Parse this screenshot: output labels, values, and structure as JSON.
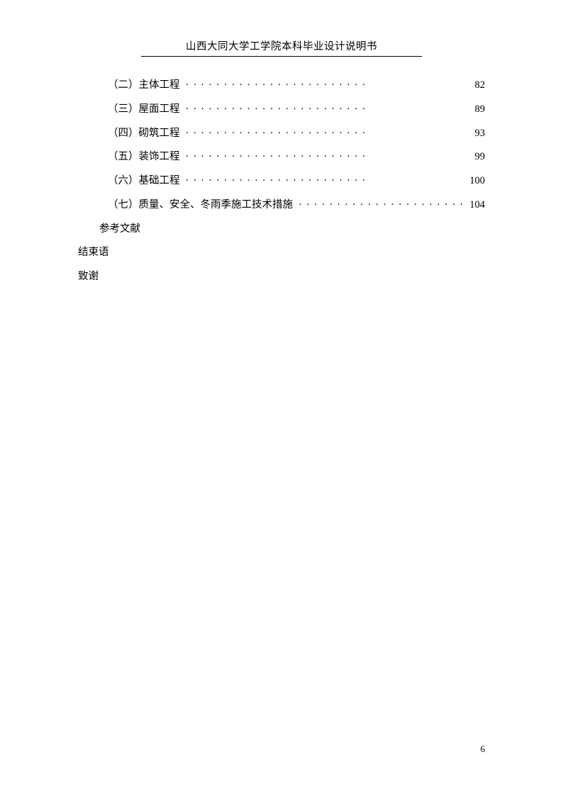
{
  "header": {
    "title": "山西大同大学工学院本科毕业设计说明书"
  },
  "toc": [
    {
      "label": "（二）主体工程",
      "page": "82"
    },
    {
      "label": "（三）屋面工程",
      "page": "89"
    },
    {
      "label": "（四）砌筑工程",
      "page": "93"
    },
    {
      "label": "（五）装饰工程",
      "page": "99"
    },
    {
      "label": "（六）基础工程",
      "page": "100"
    },
    {
      "label": "（七）质量、安全、冬雨季施工技术措施",
      "page": "104"
    }
  ],
  "references": "参考文献",
  "conclusion": "结束语",
  "thanks": "致谢",
  "dots": "························",
  "page_number": "6"
}
